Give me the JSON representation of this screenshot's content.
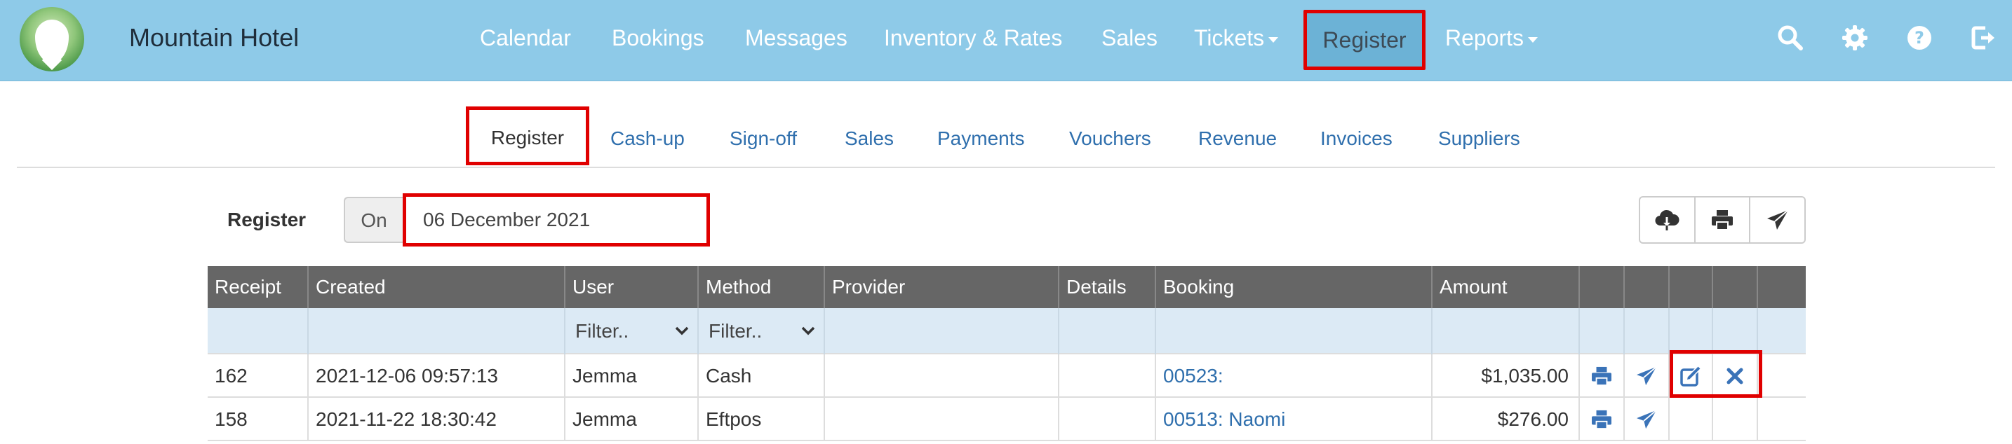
{
  "app": {
    "brand": "Mountain Hotel"
  },
  "nav": {
    "items": [
      {
        "label": "Calendar"
      },
      {
        "label": "Bookings"
      },
      {
        "label": "Messages"
      },
      {
        "label": "Inventory & Rates"
      },
      {
        "label": "Sales"
      },
      {
        "label": "Tickets"
      },
      {
        "label": "Register"
      },
      {
        "label": "Reports"
      }
    ],
    "active": "Register",
    "icons": [
      "search-icon",
      "gear-icon",
      "help-icon",
      "logout-icon"
    ]
  },
  "subnav": {
    "items": [
      {
        "label": "Register"
      },
      {
        "label": "Cash-up"
      },
      {
        "label": "Sign-off"
      },
      {
        "label": "Sales"
      },
      {
        "label": "Payments"
      },
      {
        "label": "Vouchers"
      },
      {
        "label": "Revenue"
      },
      {
        "label": "Invoices"
      },
      {
        "label": "Suppliers"
      }
    ],
    "active": "Register"
  },
  "register": {
    "label": "Register",
    "on_label": "On",
    "date_value": "06 December 2021",
    "toolbar_icons": [
      "cloud-download-icon",
      "print-icon",
      "send-icon"
    ]
  },
  "table": {
    "columns": [
      "Receipt",
      "Created",
      "User",
      "Method",
      "Provider",
      "Details",
      "Booking",
      "Amount"
    ],
    "filters": {
      "user": "Filter..",
      "method": "Filter.."
    },
    "rows": [
      {
        "receipt": "162",
        "created": "2021-12-06 09:57:13",
        "user": "Jemma",
        "method": "Cash",
        "provider": "",
        "details": "",
        "booking": "00523:",
        "amount": "$1,035.00",
        "actions": [
          "print-icon",
          "send-icon",
          "edit-icon",
          "delete-icon"
        ]
      },
      {
        "receipt": "158",
        "created": "2021-11-22 18:30:42",
        "user": "Jemma",
        "method": "Eftpos",
        "provider": "",
        "details": "",
        "booking": "00513: Naomi",
        "amount": "$276.00",
        "actions": [
          "print-icon",
          "send-icon"
        ]
      }
    ]
  },
  "colors": {
    "navbar_bg": "#8ecae8",
    "nav_active_bg": "#6cb2d6",
    "highlight": "#e00000",
    "link": "#2f6fad",
    "table_header_bg": "#666666",
    "filter_row_bg": "#dceaf5",
    "icon_blue": "#3a73b8"
  }
}
